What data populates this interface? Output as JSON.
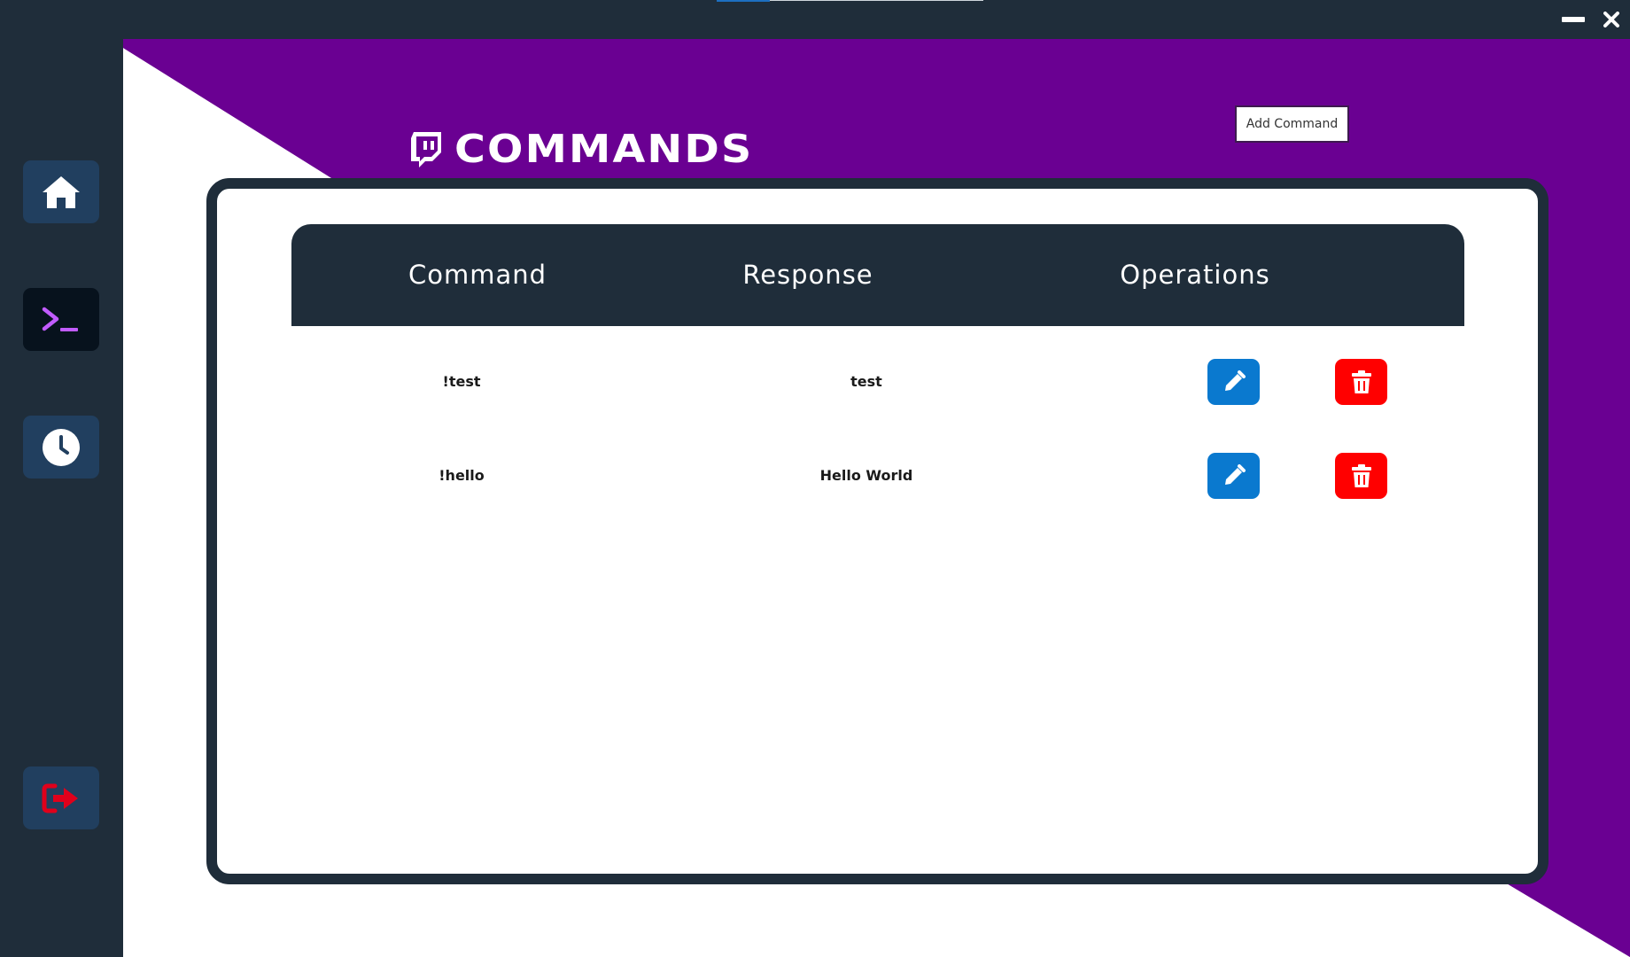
{
  "page": {
    "title": "COMMANDS",
    "add_button_label": "Add Command"
  },
  "icons": {
    "brand": "twitch-icon",
    "minimize": "minimize-icon",
    "close": "close-icon",
    "home": "home-icon",
    "terminal": "terminal-icon",
    "history": "clock-icon",
    "logout": "logout-icon",
    "edit": "pencil-icon",
    "delete": "trash-icon"
  },
  "colors": {
    "sidebar": "#1f2d3a",
    "accent_purple": "#6a0092",
    "edit_blue": "#0a79cf",
    "delete_red": "#ff0000",
    "terminal_glyph": "#c15cff",
    "logout_glyph": "#e0001b"
  },
  "table": {
    "columns": [
      "Command",
      "Response",
      "Operations"
    ],
    "rows": [
      {
        "command": "!test",
        "response": "test"
      },
      {
        "command": "!hello",
        "response": "Hello World"
      }
    ]
  }
}
